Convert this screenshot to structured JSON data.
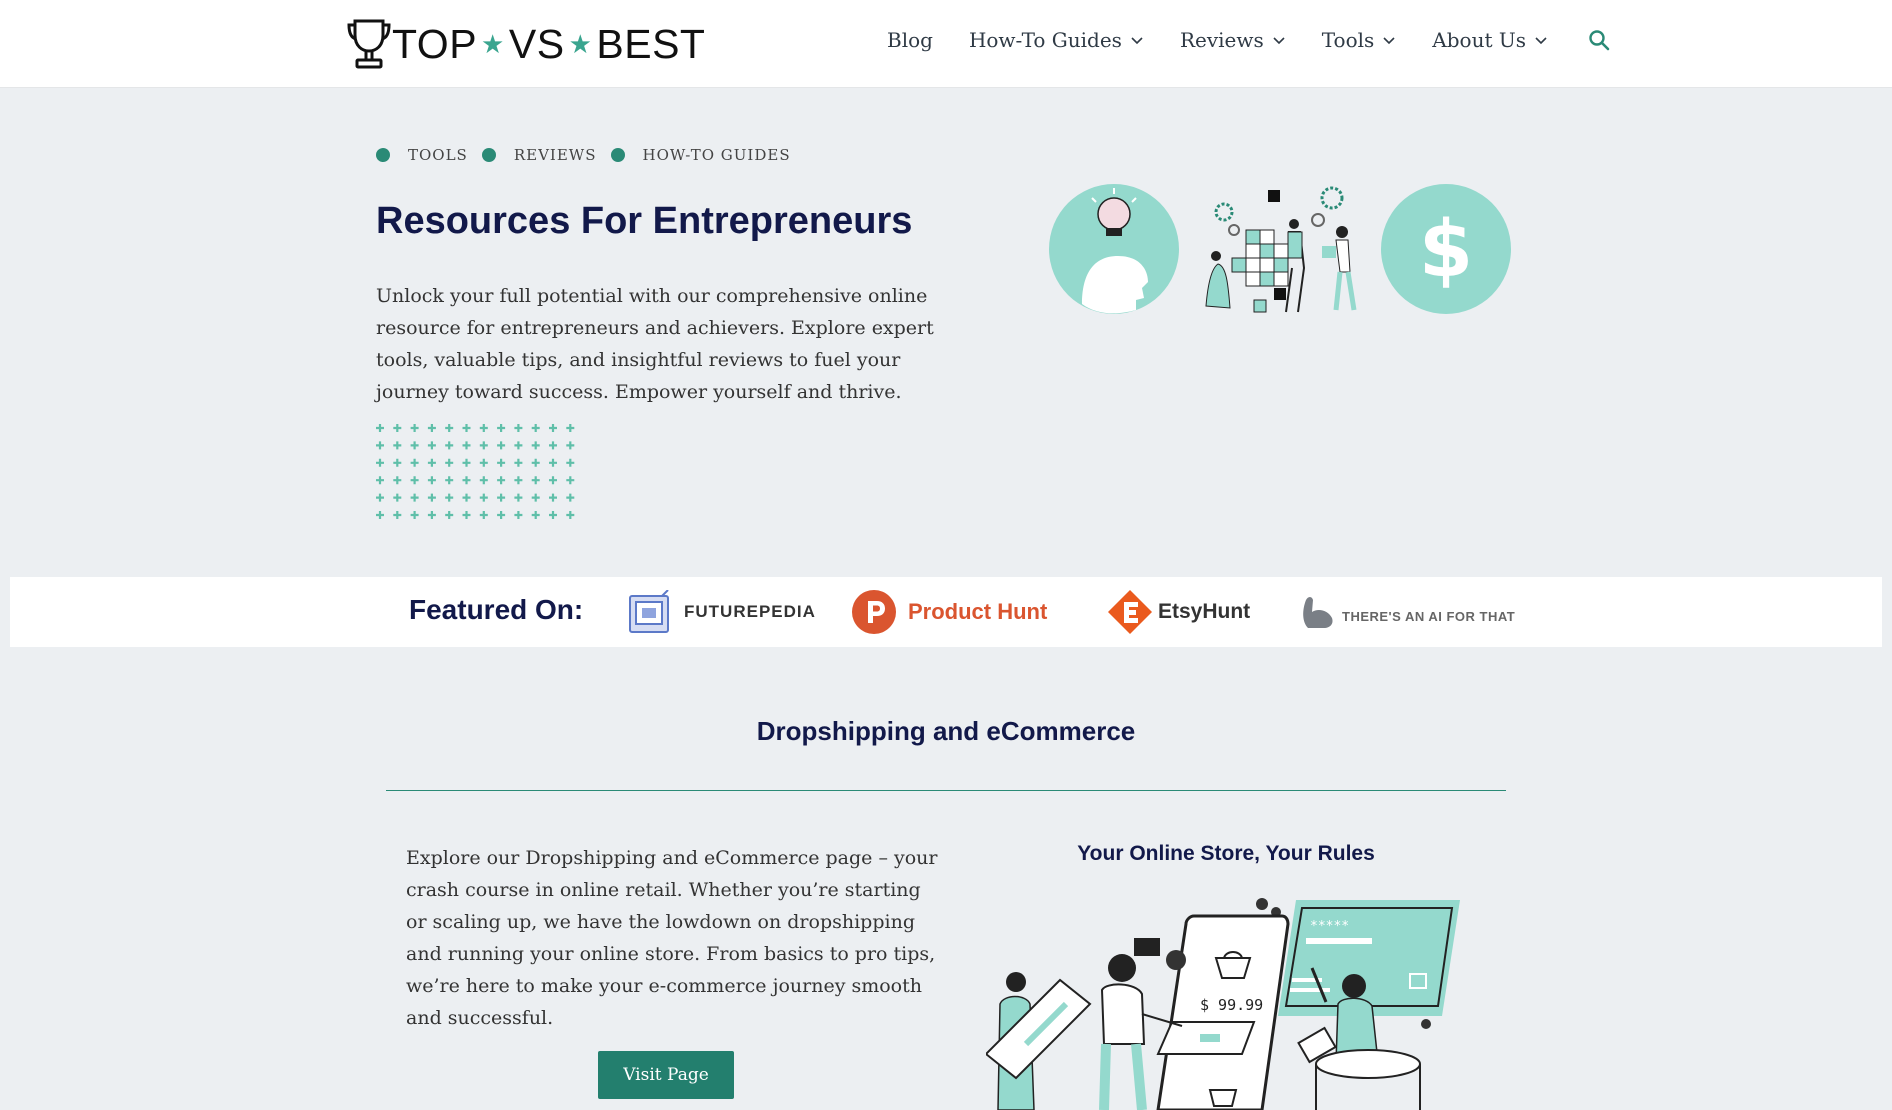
{
  "header": {
    "logo": {
      "part1": "TOP",
      "part2": "VS",
      "part3": "BEST",
      "icon": "trophy-icon"
    },
    "nav": [
      {
        "label": "Blog",
        "has_dropdown": false
      },
      {
        "label": "How-To Guides",
        "has_dropdown": true
      },
      {
        "label": "Reviews",
        "has_dropdown": true
      },
      {
        "label": "Tools",
        "has_dropdown": true
      },
      {
        "label": "About Us",
        "has_dropdown": true
      }
    ],
    "search_icon": "search-icon"
  },
  "hero": {
    "categories": [
      "TOOLS",
      "REVIEWS",
      "HOW-TO GUIDES"
    ],
    "title": "Resources For Entrepreneurs",
    "text": "Unlock your full potential with our comprehensive online resource for entrepreneurs and achievers. Explore expert tools, valuable tips, and insightful reviews to fuel your journey toward success. Empower yourself and thrive."
  },
  "featured": {
    "label": "Featured On:",
    "brands": [
      {
        "name": "FUTUREPEDIA"
      },
      {
        "name": "Product Hunt"
      },
      {
        "name": "EtsyHunt"
      },
      {
        "name": "THERE'S AN AI FOR THAT"
      }
    ]
  },
  "section": {
    "title": "Dropshipping and eCommerce",
    "text": "Explore our Dropshipping and eCommerce page – your crash course in online retail. Whether you’re starting or scaling up, we have the lowdown on dropshipping and running your online store. From basics to pro tips, we’re here to make your e-commerce journey smooth and successful.",
    "button": "Visit Page",
    "side_title": "Your Online Store, Your Rules",
    "price": "$ 99.99",
    "stars": "*****"
  },
  "colors": {
    "accent": "#2a8a76",
    "mint": "#94d9cd",
    "navy": "#12194a",
    "button": "#237f6e"
  }
}
